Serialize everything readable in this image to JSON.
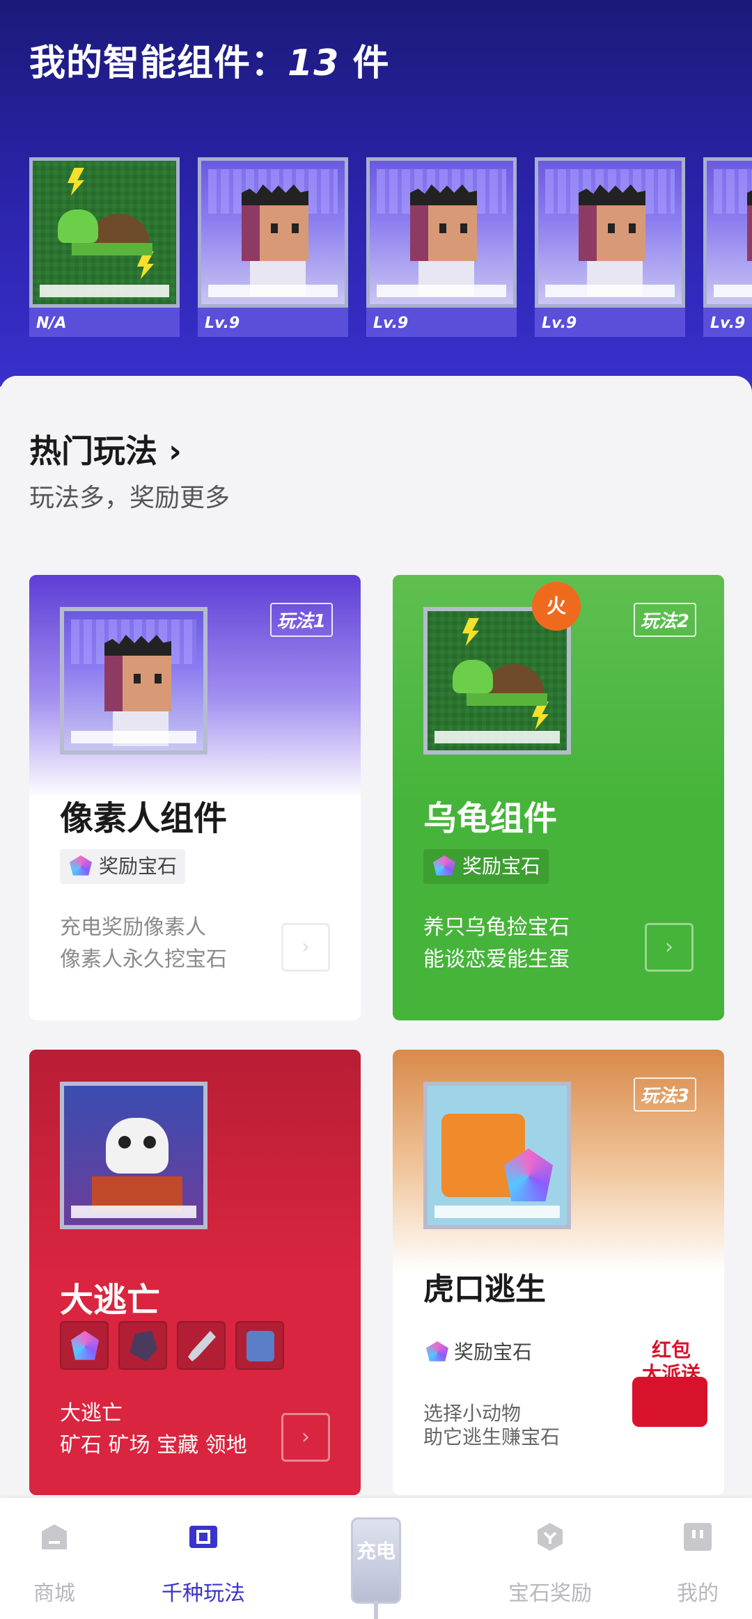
{
  "header": {
    "title_prefix": "我的智能组件：",
    "count": "13",
    "count_suffix": " 件"
  },
  "widgets": [
    {
      "label": "N/A",
      "art": "turtle"
    },
    {
      "label": "Lv.9",
      "art": "pixel-man"
    },
    {
      "label": "Lv.9",
      "art": "pixel-man"
    },
    {
      "label": "Lv.9",
      "art": "pixel-man"
    },
    {
      "label": "Lv.9",
      "art": "pixel-man"
    }
  ],
  "section": {
    "title": "热门玩法 ›",
    "subtitle": "玩法多，奖励更多"
  },
  "cards": [
    {
      "title": "像素人组件",
      "tag": "玩法1",
      "reward": "奖励宝石",
      "desc": [
        "充电奖励像素人",
        "像素人永久挖宝石"
      ]
    },
    {
      "title": "乌龟组件",
      "tag": "玩法2",
      "hot": "火",
      "reward": "奖励宝石",
      "desc": [
        "养只乌龟捡宝石",
        "能谈恋爱能生蛋"
      ]
    },
    {
      "title": "大逃亡",
      "items": [
        "gem-icon",
        "ore-icon",
        "dagger-icon",
        "backpack-icon"
      ],
      "desc": [
        "大逃亡",
        "矿石 矿场 宝藏 领地"
      ]
    },
    {
      "title": "虎口逃生",
      "tag": "玩法3",
      "reward": "奖励宝石",
      "desc": [
        "选择小动物",
        "助它逃生赚宝石"
      ],
      "promo": [
        "红包",
        "大派送"
      ]
    }
  ],
  "nav": {
    "items": [
      {
        "label": "商城",
        "icon": "shop-icon",
        "active": false
      },
      {
        "label": "千种玩法",
        "icon": "chip-icon",
        "active": true
      },
      {
        "label": "宝石奖励",
        "icon": "gem-badge-icon",
        "active": false
      },
      {
        "label": "我的",
        "icon": "profile-icon",
        "active": false
      }
    ],
    "center": {
      "label": "充电",
      "icon": "charger-icon"
    }
  },
  "colors": {
    "header_bg": "#2a23a8",
    "accent": "#3b34c9",
    "green_card": "#46b43a",
    "red_card": "#d9253f"
  }
}
